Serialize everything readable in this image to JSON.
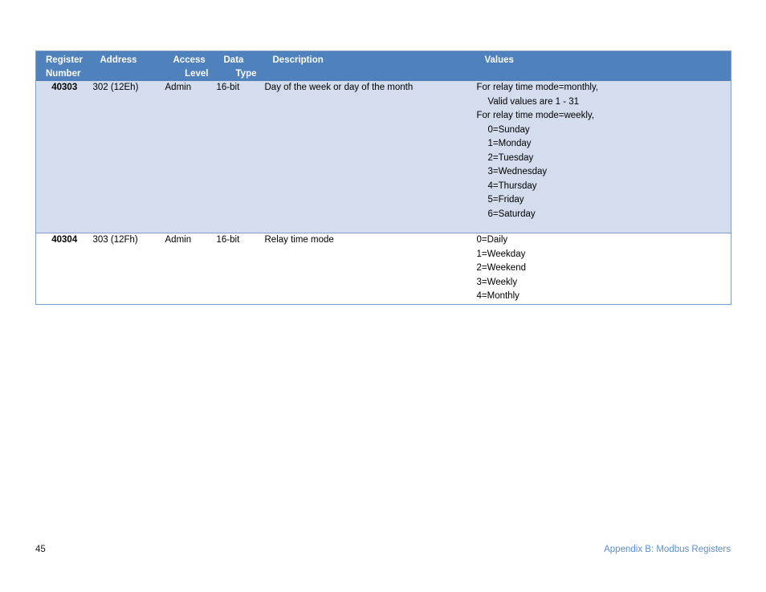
{
  "document": {
    "table": {
      "columns": [
        {
          "line1": "Register",
          "line2": "Number",
          "line2_align": "left"
        },
        {
          "line1": "Address",
          "line2": "",
          "line2_align": "left"
        },
        {
          "line1": "Access",
          "line2": "Level",
          "line2_align": "right"
        },
        {
          "line1": "Data",
          "line2": "Type",
          "line2_align": "right"
        },
        {
          "line1": "Description",
          "line2": "",
          "line2_align": "left"
        },
        {
          "line1": "Values",
          "line2": "",
          "line2_align": "left"
        }
      ],
      "rows": [
        {
          "register_number": "40303",
          "address": "302 (12Eh)",
          "access_level": "Admin",
          "data_type": "16-bit",
          "description": "Day of the week or day of the month",
          "values": [
            {
              "text": "For relay time mode=monthly,",
              "indent": false
            },
            {
              "text": "Valid values are 1 - 31",
              "indent": true
            },
            {
              "text": "For relay time mode=weekly,",
              "indent": false
            },
            {
              "text": "0=Sunday",
              "indent": true
            },
            {
              "text": "1=Monday",
              "indent": true
            },
            {
              "text": "2=Tuesday",
              "indent": true
            },
            {
              "text": "3=Wednesday",
              "indent": true
            },
            {
              "text": "4=Thursday",
              "indent": true
            },
            {
              "text": "5=Friday",
              "indent": true
            },
            {
              "text": "6=Saturday",
              "indent": true
            }
          ]
        },
        {
          "register_number": "40304",
          "address": "303 (12Fh)",
          "access_level": "Admin",
          "data_type": "16-bit",
          "description": "Relay time mode",
          "values": [
            {
              "text": "0=Daily",
              "indent": false
            },
            {
              "text": "1=Weekday",
              "indent": false
            },
            {
              "text": "2=Weekend",
              "indent": false
            },
            {
              "text": "3=Weekly",
              "indent": false
            },
            {
              "text": "4=Monthly",
              "indent": false
            }
          ]
        }
      ]
    },
    "footer": {
      "page_number": "45",
      "section_link": "Appendix B: Modbus Registers"
    },
    "colors": {
      "header_background": "#4f81bd",
      "header_text": "#ffffff",
      "row_shaded_background": "#d3dded",
      "row_plain_background": "#ffffff",
      "table_border": "#7fa0c4",
      "footer_link": "#5b8fd4"
    }
  }
}
